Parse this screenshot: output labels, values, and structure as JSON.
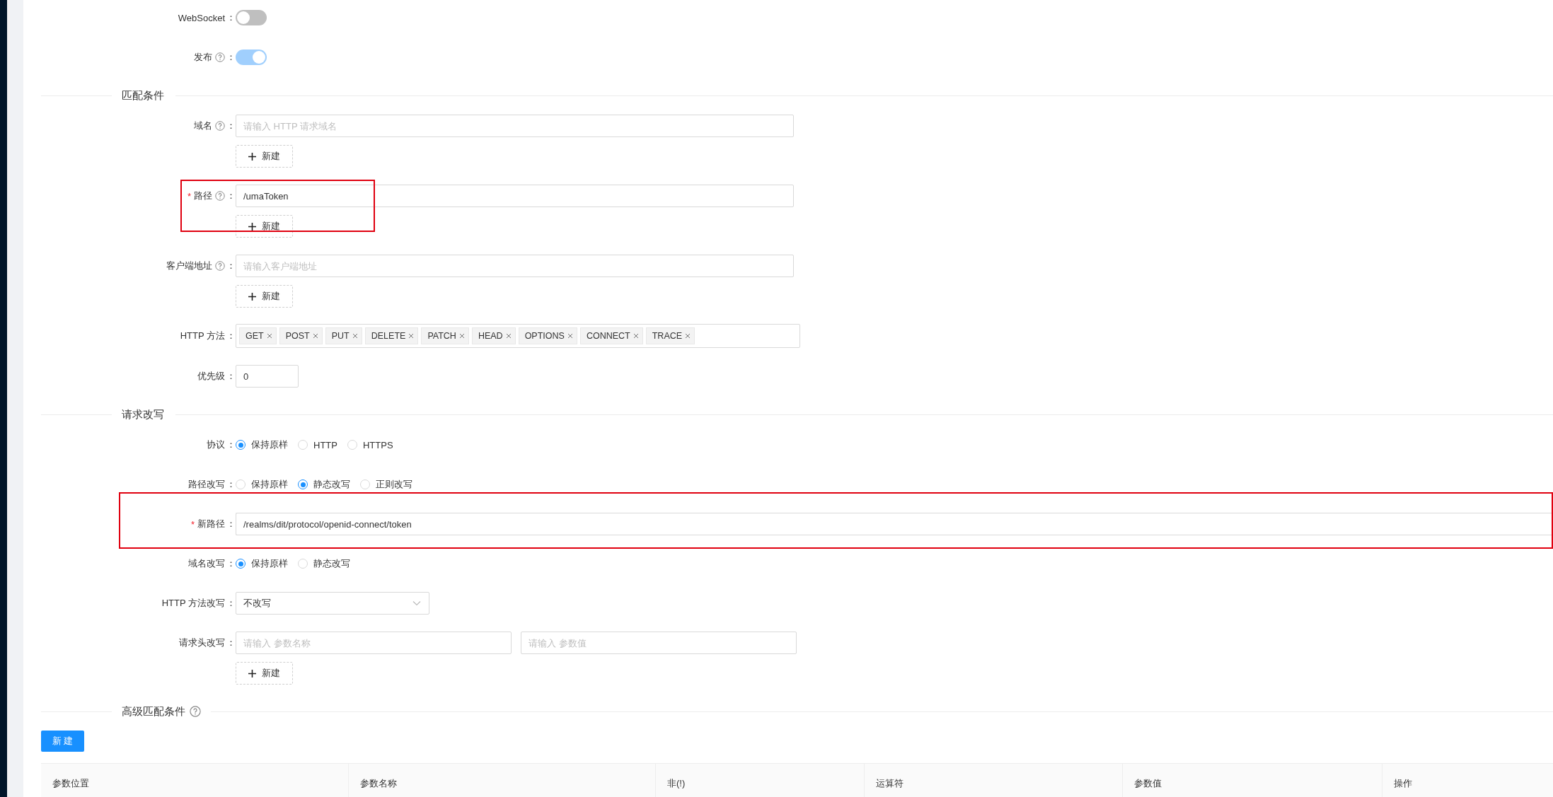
{
  "switches": [
    {
      "label": "WebSocket",
      "colon": "：",
      "on": false
    },
    {
      "label": "发布",
      "colon": "：",
      "help": true,
      "on": true
    }
  ],
  "sections": [
    {
      "title": "匹配条件",
      "items": [
        {
          "kind": "input-list",
          "label": "域名",
          "colon": "：",
          "help": true,
          "placeholder": "请输入 HTTP 请求域名",
          "add_button": "新建"
        },
        {
          "kind": "input-list",
          "label": "路径",
          "colon": "：",
          "help": true,
          "required_mark": "*",
          "value": "/umaToken",
          "add_button": "新建",
          "highlighted": true
        },
        {
          "kind": "input-list",
          "label": "客户端地址",
          "colon": "：",
          "help": true,
          "placeholder": "请输入客户端地址",
          "add_button": "新建"
        },
        {
          "kind": "tags",
          "label": "HTTP 方法",
          "colon": "：",
          "tags": [
            "GET",
            "POST",
            "PUT",
            "DELETE",
            "PATCH",
            "HEAD",
            "OPTIONS",
            "CONNECT",
            "TRACE"
          ]
        },
        {
          "kind": "number",
          "label": "优先级",
          "colon": "：",
          "value": "0"
        }
      ]
    },
    {
      "title": "请求改写",
      "items": [
        {
          "kind": "radio",
          "label": "协议",
          "colon": "：",
          "options": [
            {
              "label": "保持原样",
              "selected": true
            },
            {
              "label": "HTTP",
              "selected": false
            },
            {
              "label": "HTTPS",
              "selected": false
            }
          ]
        },
        {
          "kind": "radio",
          "label": "路径改写",
          "colon": "：",
          "options": [
            {
              "label": "保持原样",
              "selected": false
            },
            {
              "label": "静态改写",
              "selected": true
            },
            {
              "label": "正则改写",
              "selected": false
            }
          ]
        },
        {
          "kind": "input",
          "label": "新路径",
          "colon": "：",
          "required_mark": "*",
          "value": "/realms/dit/protocol/openid-connect/token",
          "highlighted": true
        },
        {
          "kind": "radio",
          "label": "域名改写",
          "colon": "：",
          "options": [
            {
              "label": "保持原样",
              "selected": true
            },
            {
              "label": "静态改写",
              "selected": false
            }
          ]
        },
        {
          "kind": "select",
          "label": "HTTP 方法改写",
          "colon": "：",
          "value": "不改写"
        },
        {
          "kind": "pair",
          "label": "请求头改写",
          "colon": "：",
          "placeholders": [
            "请输入 参数名称",
            "请输入 参数值"
          ],
          "add_button": "新建"
        }
      ]
    },
    {
      "title": "高级匹配条件",
      "help": true,
      "button": "新 建",
      "table": {
        "columns": [
          "参数位置",
          "参数名称",
          "非(!)",
          "运算符",
          "参数值",
          "操作"
        ]
      }
    }
  ]
}
